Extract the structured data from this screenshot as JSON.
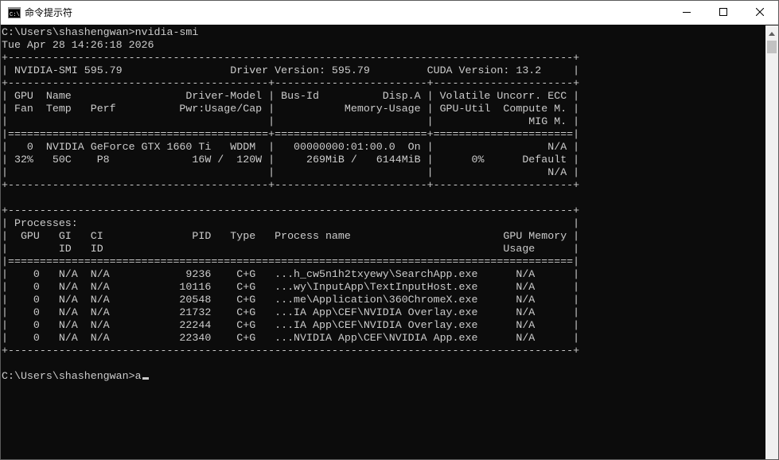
{
  "window": {
    "title": "命令提示符",
    "icon": "cmd-icon",
    "controls": {
      "minimize_icon": "minimize-icon",
      "maximize_icon": "maximize-icon",
      "close_icon": "close-icon"
    }
  },
  "colors": {
    "console_background": "#0c0c0c",
    "console_text": "#cccccc",
    "titlebar_background": "#ffffff",
    "scrollbar_track": "#f0f0f0",
    "scrollbar_thumb": "#c2c2c2"
  },
  "console": {
    "lines": [
      "C:\\Users\\shashengwan>nvidia-smi",
      "Tue Apr 28 14:26:18 2026",
      "+-----------------------------------------------------------------------------------------+",
      "| NVIDIA-SMI 595.79                 Driver Version: 595.79         CUDA Version: 13.2     |",
      "+-----------------------------------------+------------------------+----------------------+",
      "| GPU  Name                  Driver-Model | Bus-Id          Disp.A | Volatile Uncorr. ECC |",
      "| Fan  Temp   Perf          Pwr:Usage/Cap |           Memory-Usage | GPU-Util  Compute M. |",
      "|                                         |                        |               MIG M. |",
      "|=========================================+========================+======================|",
      "|   0  NVIDIA GeForce GTX 1660 Ti   WDDM  |   00000000:01:00.0  On |                  N/A |",
      "| 32%   50C    P8             16W /  120W |     269MiB /   6144MiB |      0%      Default |",
      "|                                         |                        |                  N/A |",
      "+-----------------------------------------+------------------------+----------------------+",
      "",
      "+-----------------------------------------------------------------------------------------+",
      "| Processes:                                                                              |",
      "|  GPU   GI   CI              PID   Type   Process name                        GPU Memory |",
      "|        ID   ID                                                               Usage      |",
      "|=========================================================================================|",
      "|    0   N/A  N/A            9236    C+G   ...h_cw5n1h2txyewy\\SearchApp.exe      N/A      |",
      "|    0   N/A  N/A           10116    C+G   ...wy\\InputApp\\TextInputHost.exe      N/A      |",
      "|    0   N/A  N/A           20548    C+G   ...me\\Application\\360ChromeX.exe      N/A      |",
      "|    0   N/A  N/A           21732    C+G   ...IA App\\CEF\\NVIDIA Overlay.exe      N/A      |",
      "|    0   N/A  N/A           22244    C+G   ...IA App\\CEF\\NVIDIA Overlay.exe      N/A      |",
      "|    0   N/A  N/A           22340    C+G   ...NVIDIA App\\CEF\\NVIDIA App.exe      N/A      |",
      "+-----------------------------------------------------------------------------------------+",
      "",
      "C:\\Users\\shashengwan>a"
    ],
    "cursor_line_index": 27
  },
  "scrollbar": {
    "up_arrow_icon": "scroll-up-arrow-icon"
  }
}
